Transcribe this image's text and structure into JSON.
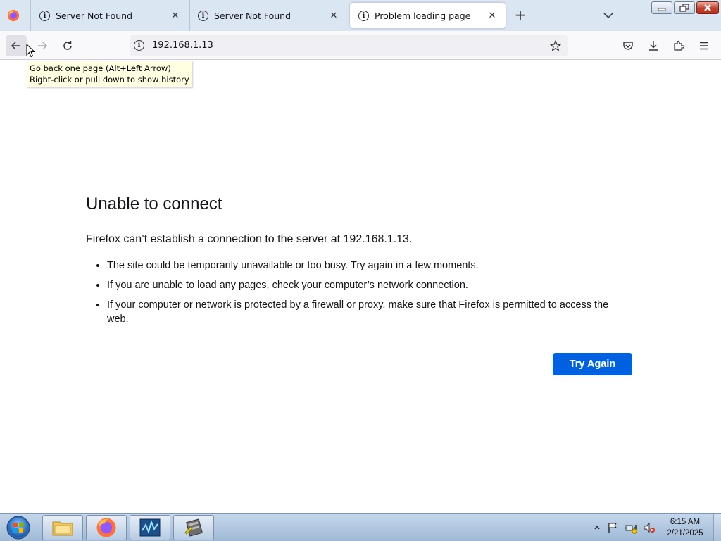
{
  "browser": {
    "tabs": [
      {
        "label": "Server Not Found",
        "icon": "info-icon",
        "selected": false
      },
      {
        "label": "Server Not Found",
        "icon": "info-icon",
        "selected": false
      },
      {
        "label": "Problem loading page",
        "icon": "info-icon",
        "selected": true
      }
    ],
    "close_glyph": "✕",
    "new_tab_glyph": "+",
    "url": "192.168.1.13"
  },
  "tooltip": {
    "line1": "Go back one page (Alt+Left Arrow)",
    "line2": "Right-click or pull down to show history"
  },
  "error_page": {
    "title": "Unable to connect",
    "description": "Firefox can’t establish a connection to the server at 192.168.1.13.",
    "bullets": [
      "The site could be temporarily unavailable or too busy. Try again in a few moments.",
      "If you are unable to load any pages, check your computer’s network connection.",
      "If your computer or network is protected by a firewall or proxy, make sure that Firefox is permitted to access the web."
    ],
    "try_again_label": "Try Again"
  },
  "taskbar": {
    "apps": [
      "file-explorer-icon",
      "firefox-icon",
      "monitor-app-icon",
      "tool-app-icon"
    ],
    "time": "6:15 AM",
    "date": "2/21/2025"
  },
  "colors": {
    "accent_button": "#0061e0",
    "tabbar_bg": "#dbe6f3",
    "tooltip_bg": "#ffffe1"
  }
}
